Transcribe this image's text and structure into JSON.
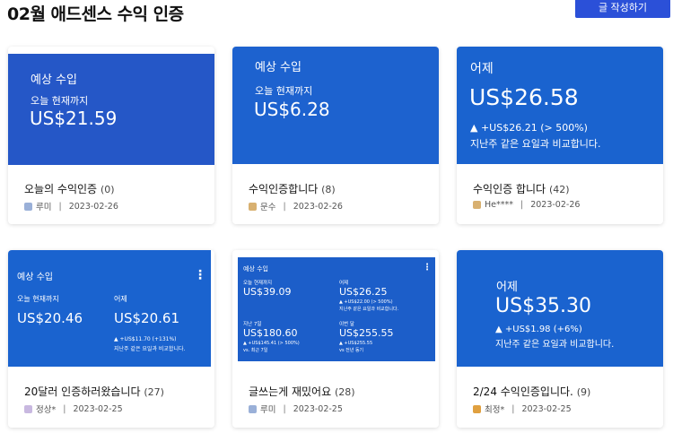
{
  "header": {
    "title": "02월 애드센스 수익 인증",
    "write_button": "글 작성하기"
  },
  "cards": [
    {
      "thumb": {
        "label": "예상 수입",
        "period": "오늘 현재까지",
        "amount": "US$21.59"
      },
      "title": "오늘의 수익인증",
      "count": "(0)",
      "author": "루미",
      "date": "2023-02-26",
      "avatar_color": "#9ab0d8"
    },
    {
      "thumb": {
        "label": "예상 수입",
        "period": "오늘 현재까지",
        "amount": "US$6.28"
      },
      "title": "수익인증합니다",
      "count": "(8)",
      "author": "문수",
      "date": "2023-02-26",
      "avatar_color": "#d8b070"
    },
    {
      "thumb": {
        "label": "어제",
        "amount": "US$26.58",
        "change": "▲ +US$26.21 (> 500%)",
        "compare": "지난주 같은 요일과 비교합니다."
      },
      "title": "수익인증 합니다",
      "count": "(42)",
      "author": "He****",
      "date": "2023-02-26",
      "avatar_color": "#d8b070"
    },
    {
      "thumb": {
        "label": "예상 수입",
        "left_period": "오늘 현재까지",
        "left_amount": "US$20.46",
        "right_period": "어제",
        "right_amount": "US$20.61",
        "right_change": "▲ +US$11.70 (+131%)",
        "right_compare": "지난주 같은 요일과 비교합니다."
      },
      "title": "20달러 인증하러왔습니다",
      "count": "(27)",
      "author": "정상*",
      "date": "2023-02-25",
      "avatar_color": "#c8b8e0"
    },
    {
      "thumb": {
        "label": "예상 수입",
        "q1_period": "오늘 현재까지",
        "q1_amount": "US$39.09",
        "q2_period": "어제",
        "q2_amount": "US$26.25",
        "q2_change": "▲ +US$22.00 (> 500%)",
        "q2_compare": "지난주 같은 요일과 비교합니다.",
        "q3_period": "지난 7일",
        "q3_amount": "US$180.60",
        "q3_change": "▲ +US$145.41 (> 500%)",
        "q3_compare": "vs. 최근 7일",
        "q4_period": "이번 달",
        "q4_amount": "US$255.55",
        "q4_change": "▲ +US$255.55",
        "q4_compare": "vs 전년 동기"
      },
      "title": "글쓰는게 재밌어요",
      "count": "(28)",
      "author": "루미",
      "date": "2023-02-25",
      "avatar_color": "#9ab0d8"
    },
    {
      "thumb": {
        "label": "어제",
        "amount": "US$35.30",
        "change": "▲ +US$1.98 (+6%)",
        "compare": "지난주 같은 요일과 비교합니다."
      },
      "title": "2/24 수익인증입니다.",
      "count": "(9)",
      "author": "최정*",
      "date": "2023-02-25",
      "avatar_color": "#e0a040"
    }
  ]
}
